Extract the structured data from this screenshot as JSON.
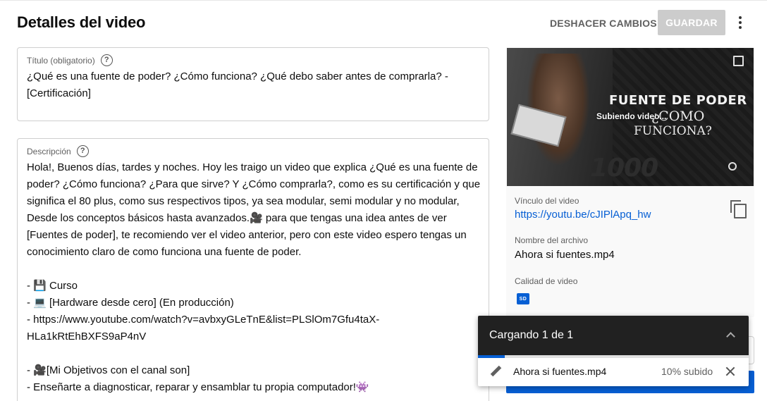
{
  "header": {
    "title": "Detalles del video",
    "undo_label": "DESHACER CAMBIOS",
    "save_label": "GUARDAR",
    "more_icon": "more-vert-icon"
  },
  "title_field": {
    "label": "Título (obligatorio)",
    "value": "¿Qué es una fuente de poder? ¿Cómo funciona? ¿Qué debo saber antes de comprarla? - [Certificación]"
  },
  "description_field": {
    "label": "Descripción",
    "lines": [
      "Hola!, Buenos días, tardes y noches. Hoy les traigo un video que explica ¿Qué es una fuente de",
      "poder? ¿Cómo funciona? ¿Para que sirve? Y ¿Cómo comprarla?, como es su certificación y que",
      "significa el 80 plus, como sus respectivos tipos, ya sea modular, semi modular y no modular,",
      "Desde los conceptos básicos hasta avanzados.🎥  para que tengas una idea antes de ver",
      "[Fuentes de poder], te recomiendo ver el video anterior, pero con este video espero tengas un",
      "conocimiento claro de como funciona una fuente de poder.",
      "",
      "- 💾 Curso",
      "- 💻 [Hardware desde cero] (En producción)",
      "- https://www.youtube.com/watch?v=avbxyGLeTnE&list=PLSlOm7Gfu4taX-",
      "HLa1kRtEhBXFS9aP4nV",
      "",
      "- 🎥[Mi Objetivos con el canal son]",
      "- Enseñarte a diagnosticar, reparar y ensamblar tu propia computador!👾"
    ]
  },
  "thumbnail": {
    "headline": "FUENTE DE PODER",
    "subline1": "¿COMO",
    "subline2": "FUNCIONA?",
    "brand": "1000",
    "status": "Subiendo video..."
  },
  "video_info": {
    "link_label": "Vínculo del video",
    "link_url": "https://youtu.be/cJIPlApq_hw",
    "filename_label": "Nombre del archivo",
    "filename": "Ahora si fuentes.mp4",
    "quality_label": "Calidad de video",
    "quality_badge": "SD"
  },
  "upload_popup": {
    "title": "Cargando 1 de 1",
    "file": "Ahora si fuentes.mp4",
    "status": "10% subido",
    "progress": 0.1
  },
  "colors": {
    "accent": "#065fd4",
    "popup_header": "#212121",
    "save_disabled": "#cccccc"
  }
}
